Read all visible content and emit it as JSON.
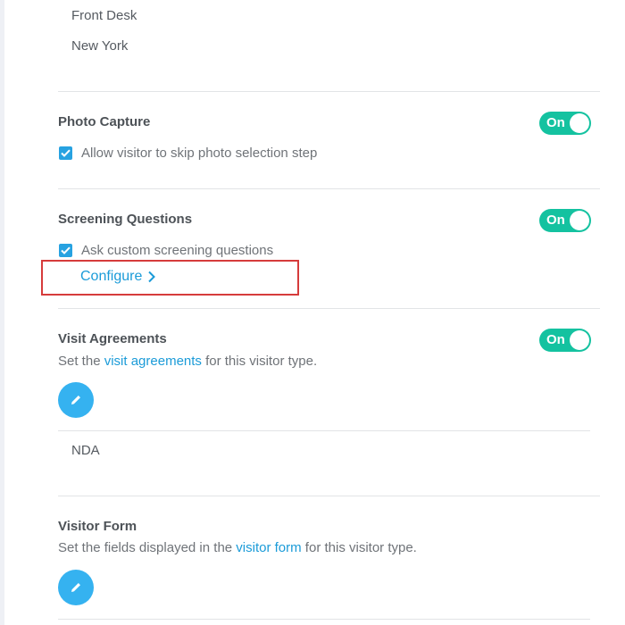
{
  "locations": {
    "item1": "Front Desk",
    "item2": "New York"
  },
  "photo_capture": {
    "title": "Photo Capture",
    "toggle_label": "On",
    "checkbox_label": "Allow visitor to skip photo selection step"
  },
  "screening_questions": {
    "title": "Screening Questions",
    "toggle_label": "On",
    "checkbox_label": "Ask custom screening questions",
    "configure_label": "Configure"
  },
  "visit_agreements": {
    "title": "Visit Agreements",
    "toggle_label": "On",
    "desc_prefix": "Set the ",
    "desc_link": "visit agreements",
    "desc_suffix": " for this visitor type.",
    "agreement_item": "NDA"
  },
  "visitor_form": {
    "title": "Visitor Form",
    "desc_prefix": "Set the fields displayed in the ",
    "desc_link": "visitor form",
    "desc_suffix": " for this visitor type."
  },
  "colors": {
    "accent": "#1b9bd8",
    "toggle_on": "#14c2a0",
    "highlight": "#d63b3b",
    "edit_button": "#35b2f0"
  },
  "icons": {
    "checkbox": "checkmark-icon",
    "configure": "chevron-right-icon",
    "edit": "pencil-icon"
  }
}
